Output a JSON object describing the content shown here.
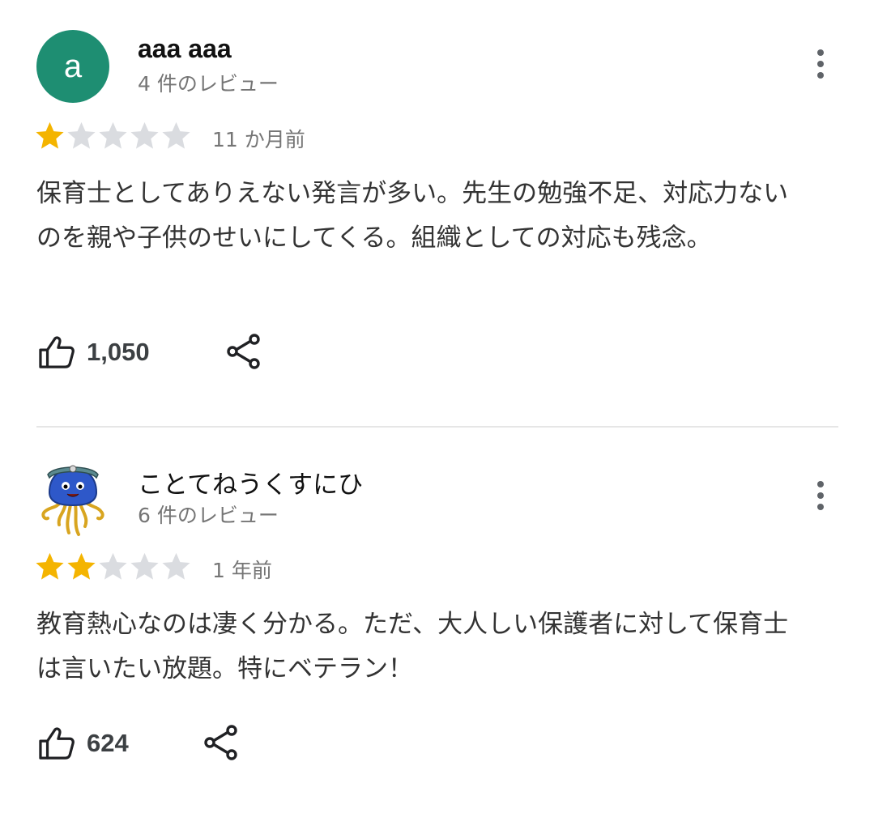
{
  "reviews": [
    {
      "avatar_letter": "a",
      "author": "aaa aaa",
      "review_count": "4 件のレビュー",
      "rating": 1,
      "max_rating": 5,
      "date": "11 か月前",
      "text": "保育士としてありえない発言が多い。先生の勉強不足、対応力ないのを親や子供のせいにしてくる。組織としての対応も残念。",
      "likes": "1,050",
      "avatar_color": "#1e8e72"
    },
    {
      "avatar_letter": "",
      "author": "ことてねうくすにひ",
      "review_count": "6 件のレビュー",
      "rating": 2,
      "max_rating": 5,
      "date": "1 年前",
      "text": "教育熱心なのは凄く分かる。ただ、大人しい保護者に対して保育士は言いたい放題。特にベテラン！",
      "likes": "624",
      "avatar_icon": "slime-knight-avatar-icon"
    }
  ],
  "colors": {
    "star_filled": "#f4b400",
    "star_empty": "#dadce0",
    "divider": "#e6e6e6"
  },
  "icons": {
    "like": "thumbs-up-icon",
    "share": "share-icon",
    "more": "more-vert-icon"
  }
}
